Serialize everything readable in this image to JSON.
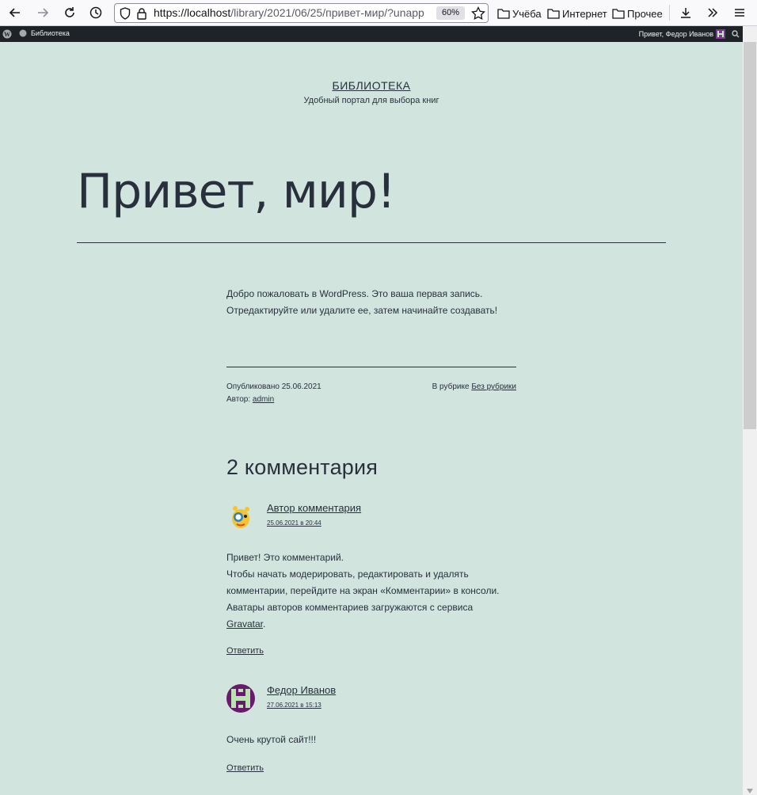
{
  "browser": {
    "url_host": "https://localhost",
    "url_path": "/library/2021/06/25/привет-мир/?unapp",
    "zoom": "60%",
    "bookmarks": [
      "Учёба",
      "Интернет",
      "Прочее"
    ]
  },
  "admin_bar": {
    "site_name": "Библиотека",
    "howdy": "Привет, Федор Иванов"
  },
  "site": {
    "title": "БИБЛИОТЕКА",
    "description": "Удобный портал для выбора книг"
  },
  "post": {
    "title": "Привет, мир!",
    "content_line1": "Добро пожаловать в WordPress. Это ваша первая запись.",
    "content_line2": "Отредактируйте или удалите ее, затем начинайте создавать!",
    "published_label": "Опубликовано",
    "published_date": "25.06.2021",
    "author_label": "Автор:",
    "author": "admin",
    "category_label": "В рубрике",
    "category": "Без рубрики"
  },
  "comments": {
    "title": "2 комментария",
    "items": [
      {
        "author": "Автор комментария",
        "date": "25.06.2021 в 20:44",
        "lines": [
          "Привет! Это комментарий.",
          "Чтобы начать модерировать, редактировать и удалять",
          "комментарии, перейдите на экран «Комментарии» в консоли.",
          "Аватары авторов комментариев загружаются с сервиса"
        ],
        "link": "Gravatar",
        "link_suffix": ".",
        "reply": "Ответить"
      },
      {
        "author": "Федор Иванов",
        "date": "27.06.2021 в 15:13",
        "lines": [
          "Очень крутой сайт!!!"
        ],
        "reply": "Ответить"
      }
    ]
  }
}
